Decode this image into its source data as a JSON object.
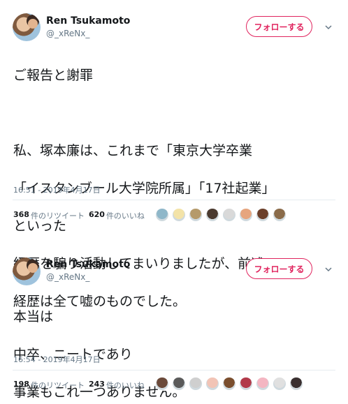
{
  "tweets": [
    {
      "name": "Ren Tsukamoto",
      "handle": "@_xReNx_",
      "follow_label": "フォローする",
      "lines": [
        "ご報告と謝罪",
        "",
        "私、塚本廉は、これまで「東京大学卒業",
        "「イスタンブール大学院所属」「17社起業」",
        "といった",
        "経歴を騙り活動してまいりましたが、前述の",
        "経歴は全て嘘のものでした。"
      ],
      "timestamp": "16:51 - 2019年4月17日",
      "retweets_count": "368",
      "retweets_label": "件のリツイート",
      "likes_count": "620",
      "likes_label": "件のいいね",
      "liker_colors": [
        "#8fb7c9",
        "#f3e3a8",
        "#b59a6b",
        "#4a3a2f",
        "#d9d9d9",
        "#e6a57e",
        "#6b3f2a",
        "#8a6b4a"
      ]
    },
    {
      "name": "Ren Tsukamoto",
      "handle": "@_xReNx_",
      "follow_label": "フォローする",
      "lines": [
        "本当は",
        "中卒、ニートであり",
        "事業もこれ一つありません。"
      ],
      "timestamp": "16:54 - 2019年4月17日",
      "retweets_count": "198",
      "retweets_label": "件のリツイート",
      "likes_count": "243",
      "likes_label": "件のいいね",
      "liker_colors": [
        "#6b4a3a",
        "#5a5a5a",
        "#cfcfcf",
        "#f2c4b6",
        "#7a4e2e",
        "#b23a4a",
        "#f4b6c2",
        "#e0e0e0",
        "#3a3030"
      ]
    }
  ]
}
